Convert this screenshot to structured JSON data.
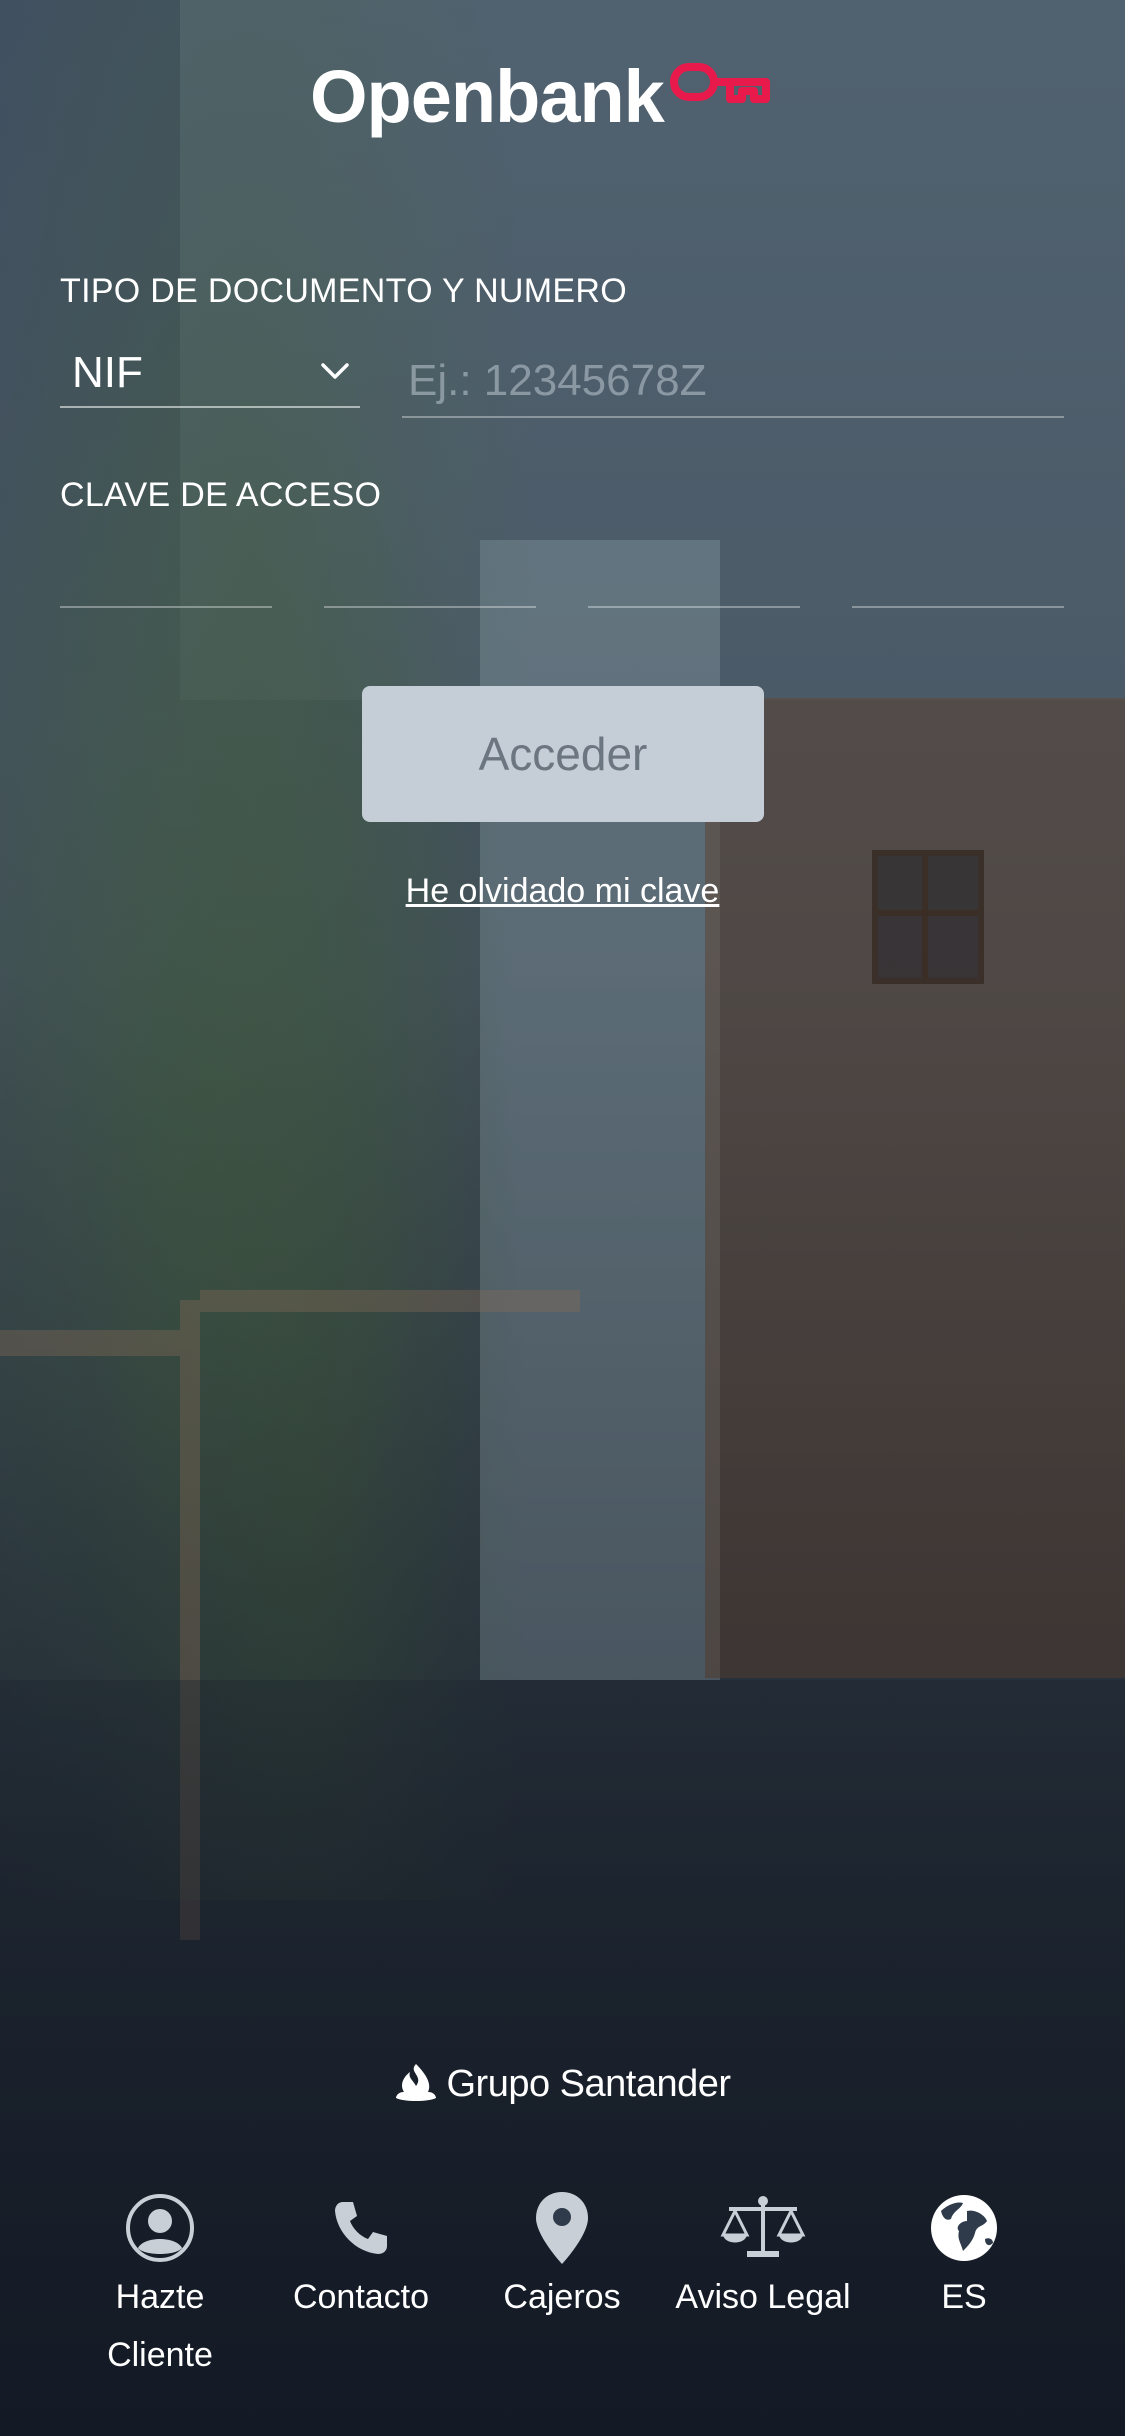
{
  "brand": {
    "logo_text": "Openbank",
    "accent_color": "#e8194b",
    "group_name": "Grupo Santander"
  },
  "login": {
    "document_label": "TIPO DE DOCUMENTO Y NUMERO",
    "document_type": "NIF",
    "document_placeholder": "Ej.: 12345678Z",
    "password_label": "CLAVE DE ACCESO",
    "submit_label": "Acceder",
    "forgot_label": "He olvidado mi clave"
  },
  "nav": {
    "items": [
      {
        "icon": "user-circle-icon",
        "label_line1": "Hazte",
        "label_line2": "Cliente"
      },
      {
        "icon": "phone-icon",
        "label_line1": "Contacto",
        "label_line2": ""
      },
      {
        "icon": "location-pin-icon",
        "label_line1": "Cajeros",
        "label_line2": ""
      },
      {
        "icon": "scales-icon",
        "label_line1": "Aviso Legal",
        "label_line2": ""
      },
      {
        "icon": "globe-icon",
        "label_line1": "ES",
        "label_line2": ""
      }
    ]
  }
}
